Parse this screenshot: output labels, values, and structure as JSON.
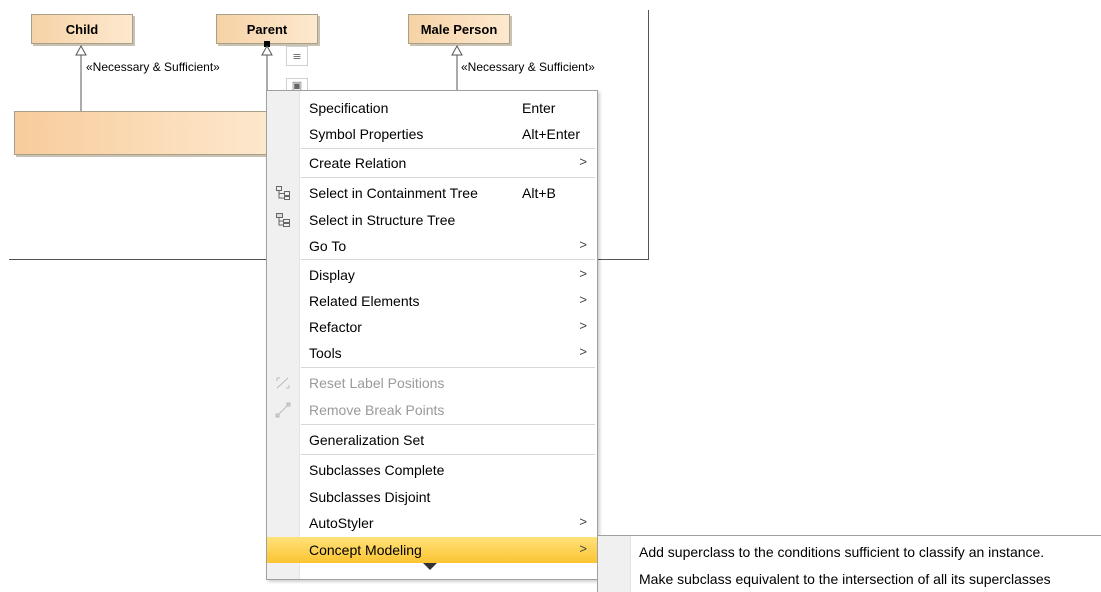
{
  "diagram": {
    "classes": {
      "child": "Child",
      "parent": "Parent",
      "male_person": "Male Person"
    },
    "stereotype_left": "«Necessary & Sufficient»",
    "stereotype_right": "«Necessary & Sufficient»"
  },
  "menu": {
    "items": [
      {
        "label": "Specification",
        "shortcut": "Enter"
      },
      {
        "label": "Symbol Properties",
        "shortcut": "Alt+Enter"
      },
      {
        "label": "Create Relation",
        "arrow": ">"
      },
      {
        "label": "Select in Containment Tree",
        "shortcut": "Alt+B",
        "icon": "containment-tree-icon"
      },
      {
        "label": "Select in Structure Tree",
        "icon": "structure-tree-icon"
      },
      {
        "label": "Go To",
        "arrow": ">"
      },
      {
        "label": "Display",
        "arrow": ">"
      },
      {
        "label": "Related Elements",
        "arrow": ">"
      },
      {
        "label": "Refactor",
        "arrow": ">"
      },
      {
        "label": "Tools",
        "arrow": ">"
      },
      {
        "label": "Reset Label Positions",
        "disabled": true,
        "icon": "reset-label-positions-icon"
      },
      {
        "label": "Remove Break Points",
        "disabled": true,
        "icon": "remove-break-points-icon"
      },
      {
        "label": "Generalization Set"
      },
      {
        "label": "Subclasses Complete"
      },
      {
        "label": "Subclasses Disjoint"
      },
      {
        "label": "AutoStyler",
        "arrow": ">"
      },
      {
        "label": "Concept Modeling",
        "arrow": ">",
        "selected": true
      }
    ]
  },
  "submenu": {
    "items": [
      {
        "label": "Add superclass to the conditions sufficient to classify an instance."
      },
      {
        "label": "Make subclass equivalent to the intersection of all its superclasses"
      }
    ]
  },
  "colors": {
    "selected_gradient_top": "#ffe27a",
    "selected_gradient_bottom": "#fbc431",
    "class_fill": "#fde9cf"
  }
}
